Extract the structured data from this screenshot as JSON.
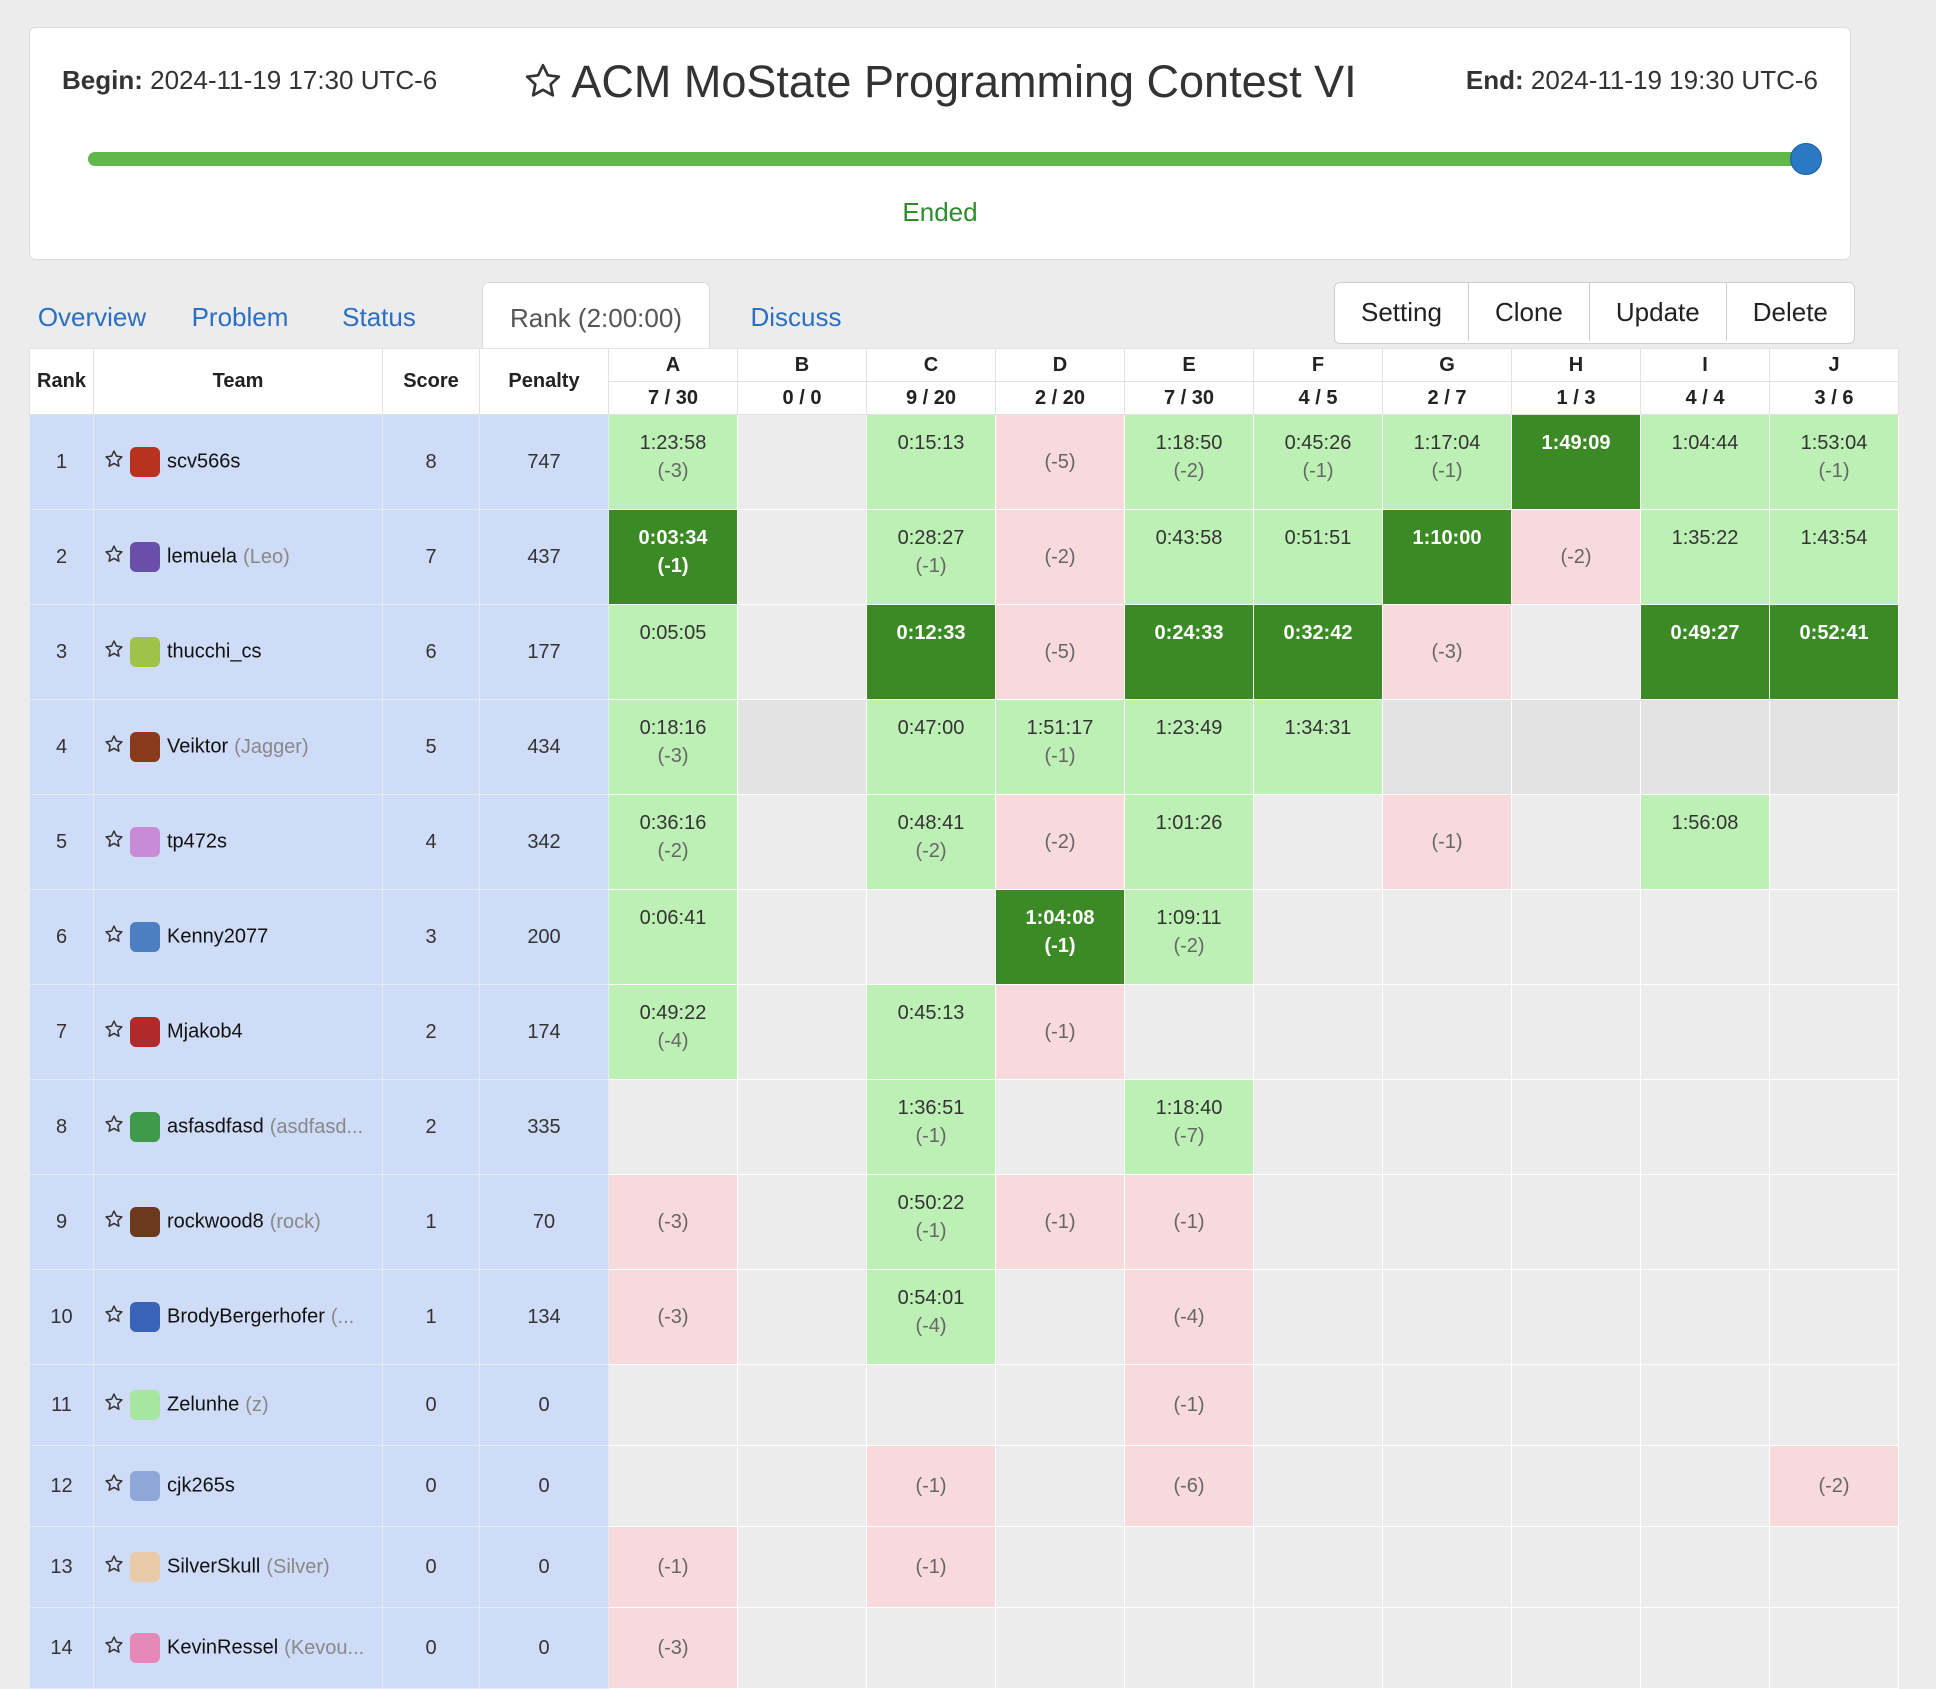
{
  "contest": {
    "begin_label": "Begin:",
    "begin": "2024-11-19 17:30 UTC-6",
    "end_label": "End:",
    "end": "2024-11-19 19:30 UTC-6",
    "title": "ACM MoState Programming Contest VI",
    "progress": 1.0,
    "status": "Ended"
  },
  "tabs": [
    "Overview",
    "Problem",
    "Status",
    "Rank (2:00:00)",
    "Discuss"
  ],
  "active_tab": 3,
  "actions": [
    "Setting",
    "Clone",
    "Update",
    "Delete"
  ],
  "columns": {
    "rank": "Rank",
    "team": "Team",
    "score": "Score",
    "penalty": "Penalty"
  },
  "problems": [
    {
      "id": "A",
      "stat": "7 / 30"
    },
    {
      "id": "B",
      "stat": "0 / 0"
    },
    {
      "id": "C",
      "stat": "9 / 20"
    },
    {
      "id": "D",
      "stat": "2 / 20"
    },
    {
      "id": "E",
      "stat": "7 / 30"
    },
    {
      "id": "F",
      "stat": "4 / 5"
    },
    {
      "id": "G",
      "stat": "2 / 7"
    },
    {
      "id": "H",
      "stat": "1 / 3"
    },
    {
      "id": "I",
      "stat": "4 / 4"
    },
    {
      "id": "J",
      "stat": "3 / 6"
    }
  ],
  "colors": {
    "accepted": "#bdf0b4",
    "first_blood": "#3c8a26",
    "wrong": "#f9dadc",
    "no_submission": "#ececec",
    "frozen": "#e3e3e3",
    "team_cols": "#cfdcf7",
    "link": "#2a6fc4",
    "progress": "#62b74a"
  },
  "rows": [
    {
      "rank": "1",
      "name": "scv566s",
      "nick": "",
      "avatar": "#b8321f",
      "score": "8",
      "penalty": "747",
      "cells": [
        [
          "ac",
          "1:23:58",
          "(-3)"
        ],
        [
          "e"
        ],
        [
          "ac",
          "0:15:13",
          ""
        ],
        [
          "wa",
          "",
          "(-5)"
        ],
        [
          "ac",
          "1:18:50",
          "(-2)"
        ],
        [
          "ac",
          "0:45:26",
          "(-1)"
        ],
        [
          "ac",
          "1:17:04",
          "(-1)"
        ],
        [
          "fb",
          "1:49:09",
          ""
        ],
        [
          "ac",
          "1:04:44",
          ""
        ],
        [
          "ac",
          "1:53:04",
          "(-1)"
        ]
      ]
    },
    {
      "rank": "2",
      "name": "lemuela",
      "nick": "(Leo)",
      "avatar": "#6a4fa8",
      "score": "7",
      "penalty": "437",
      "cells": [
        [
          "fb",
          "0:03:34",
          "(-1)"
        ],
        [
          "e"
        ],
        [
          "ac",
          "0:28:27",
          "(-1)"
        ],
        [
          "wa",
          "",
          "(-2)"
        ],
        [
          "ac",
          "0:43:58",
          ""
        ],
        [
          "ac",
          "0:51:51",
          ""
        ],
        [
          "fb",
          "1:10:00",
          ""
        ],
        [
          "wa",
          "",
          "(-2)"
        ],
        [
          "ac",
          "1:35:22",
          ""
        ],
        [
          "ac",
          "1:43:54",
          ""
        ]
      ]
    },
    {
      "rank": "3",
      "name": "thucchi_cs",
      "nick": "",
      "avatar": "#9fc24a",
      "score": "6",
      "penalty": "177",
      "cells": [
        [
          "ac",
          "0:05:05",
          ""
        ],
        [
          "e"
        ],
        [
          "fb",
          "0:12:33",
          ""
        ],
        [
          "wa",
          "",
          "(-5)"
        ],
        [
          "fb",
          "0:24:33",
          ""
        ],
        [
          "fb",
          "0:32:42",
          ""
        ],
        [
          "wa",
          "",
          "(-3)"
        ],
        [
          "e"
        ],
        [
          "fb",
          "0:49:27",
          ""
        ],
        [
          "fb",
          "0:52:41",
          ""
        ]
      ]
    },
    {
      "rank": "4",
      "name": "Veiktor",
      "nick": "(Jagger)",
      "avatar": "#8a3a1c",
      "score": "5",
      "penalty": "434",
      "cells": [
        [
          "ac",
          "0:18:16",
          "(-3)"
        ],
        [
          "n"
        ],
        [
          "ac",
          "0:47:00",
          ""
        ],
        [
          "ac",
          "1:51:17",
          "(-1)"
        ],
        [
          "ac",
          "1:23:49",
          ""
        ],
        [
          "ac",
          "1:34:31",
          ""
        ],
        [
          "n"
        ],
        [
          "n"
        ],
        [
          "n"
        ],
        [
          "n"
        ]
      ]
    },
    {
      "rank": "5",
      "name": "tp472s",
      "nick": "",
      "avatar": "#c98ad6",
      "score": "4",
      "penalty": "342",
      "cells": [
        [
          "ac",
          "0:36:16",
          "(-2)"
        ],
        [
          "e"
        ],
        [
          "ac",
          "0:48:41",
          "(-2)"
        ],
        [
          "wa",
          "",
          "(-2)"
        ],
        [
          "ac",
          "1:01:26",
          ""
        ],
        [
          "e"
        ],
        [
          "wa",
          "",
          "(-1)"
        ],
        [
          "e"
        ],
        [
          "ac",
          "1:56:08",
          ""
        ],
        [
          "e"
        ]
      ]
    },
    {
      "rank": "6",
      "name": "Kenny2077",
      "nick": "",
      "avatar": "#4b7fc2",
      "score": "3",
      "penalty": "200",
      "cells": [
        [
          "ac",
          "0:06:41",
          ""
        ],
        [
          "e"
        ],
        [
          "e"
        ],
        [
          "fb",
          "1:04:08",
          "(-1)"
        ],
        [
          "ac",
          "1:09:11",
          "(-2)"
        ],
        [
          "e"
        ],
        [
          "e"
        ],
        [
          "e"
        ],
        [
          "e"
        ],
        [
          "e"
        ]
      ]
    },
    {
      "rank": "7",
      "name": "Mjakob4",
      "nick": "",
      "avatar": "#b02a2a",
      "score": "2",
      "penalty": "174",
      "cells": [
        [
          "ac",
          "0:49:22",
          "(-4)"
        ],
        [
          "e"
        ],
        [
          "ac",
          "0:45:13",
          ""
        ],
        [
          "wa",
          "",
          "(-1)"
        ],
        [
          "e"
        ],
        [
          "e"
        ],
        [
          "e"
        ],
        [
          "e"
        ],
        [
          "e"
        ],
        [
          "e"
        ]
      ]
    },
    {
      "rank": "8",
      "name": "asfasdfasd",
      "nick": "(asdfasd...",
      "avatar": "#3f9a4a",
      "score": "2",
      "penalty": "335",
      "cells": [
        [
          "e"
        ],
        [
          "e"
        ],
        [
          "ac",
          "1:36:51",
          "(-1)"
        ],
        [
          "e"
        ],
        [
          "ac",
          "1:18:40",
          "(-7)"
        ],
        [
          "e"
        ],
        [
          "e"
        ],
        [
          "e"
        ],
        [
          "e"
        ],
        [
          "e"
        ]
      ]
    },
    {
      "rank": "9",
      "name": "rockwood8",
      "nick": "(rock)",
      "avatar": "#6b3a1e",
      "score": "1",
      "penalty": "70",
      "cells": [
        [
          "wa",
          "",
          "(-3)"
        ],
        [
          "e"
        ],
        [
          "ac",
          "0:50:22",
          "(-1)"
        ],
        [
          "wa",
          "",
          "(-1)"
        ],
        [
          "wa",
          "",
          "(-1)"
        ],
        [
          "e"
        ],
        [
          "e"
        ],
        [
          "e"
        ],
        [
          "e"
        ],
        [
          "e"
        ]
      ]
    },
    {
      "rank": "10",
      "name": "BrodyBergerhofer",
      "nick": "(...",
      "avatar": "#3a63b8",
      "score": "1",
      "penalty": "134",
      "cells": [
        [
          "wa",
          "",
          "(-3)"
        ],
        [
          "e"
        ],
        [
          "ac",
          "0:54:01",
          "(-4)"
        ],
        [
          "e"
        ],
        [
          "wa",
          "",
          "(-4)"
        ],
        [
          "e"
        ],
        [
          "e"
        ],
        [
          "e"
        ],
        [
          "e"
        ],
        [
          "e"
        ]
      ]
    },
    {
      "rank": "11",
      "name": "Zelunhe",
      "nick": "(z)",
      "avatar": "#a7e6a0",
      "score": "0",
      "penalty": "0",
      "cells": [
        [
          "e"
        ],
        [
          "e"
        ],
        [
          "e"
        ],
        [
          "e"
        ],
        [
          "wa",
          "",
          "(-1)"
        ],
        [
          "e"
        ],
        [
          "e"
        ],
        [
          "e"
        ],
        [
          "e"
        ],
        [
          "e"
        ]
      ]
    },
    {
      "rank": "12",
      "name": "cjk265s",
      "nick": "",
      "avatar": "#8fa6d8",
      "score": "0",
      "penalty": "0",
      "cells": [
        [
          "e"
        ],
        [
          "e"
        ],
        [
          "wa",
          "",
          "(-1)"
        ],
        [
          "e"
        ],
        [
          "wa",
          "",
          "(-6)"
        ],
        [
          "e"
        ],
        [
          "e"
        ],
        [
          "e"
        ],
        [
          "e"
        ],
        [
          "wa",
          "",
          "(-2)"
        ]
      ]
    },
    {
      "rank": "13",
      "name": "SilverSkull",
      "nick": "(Silver)",
      "avatar": "#e8c9a8",
      "score": "0",
      "penalty": "0",
      "cells": [
        [
          "wa",
          "",
          "(-1)"
        ],
        [
          "e"
        ],
        [
          "wa",
          "",
          "(-1)"
        ],
        [
          "e"
        ],
        [
          "e"
        ],
        [
          "e"
        ],
        [
          "e"
        ],
        [
          "e"
        ],
        [
          "e"
        ],
        [
          "e"
        ]
      ]
    },
    {
      "rank": "14",
      "name": "KevinRessel",
      "nick": "(Kevou...",
      "avatar": "#e58ab8",
      "score": "0",
      "penalty": "0",
      "cells": [
        [
          "wa",
          "",
          "(-3)"
        ],
        [
          "e"
        ],
        [
          "e"
        ],
        [
          "e"
        ],
        [
          "e"
        ],
        [
          "e"
        ],
        [
          "e"
        ],
        [
          "e"
        ],
        [
          "e"
        ],
        [
          "e"
        ]
      ]
    }
  ]
}
